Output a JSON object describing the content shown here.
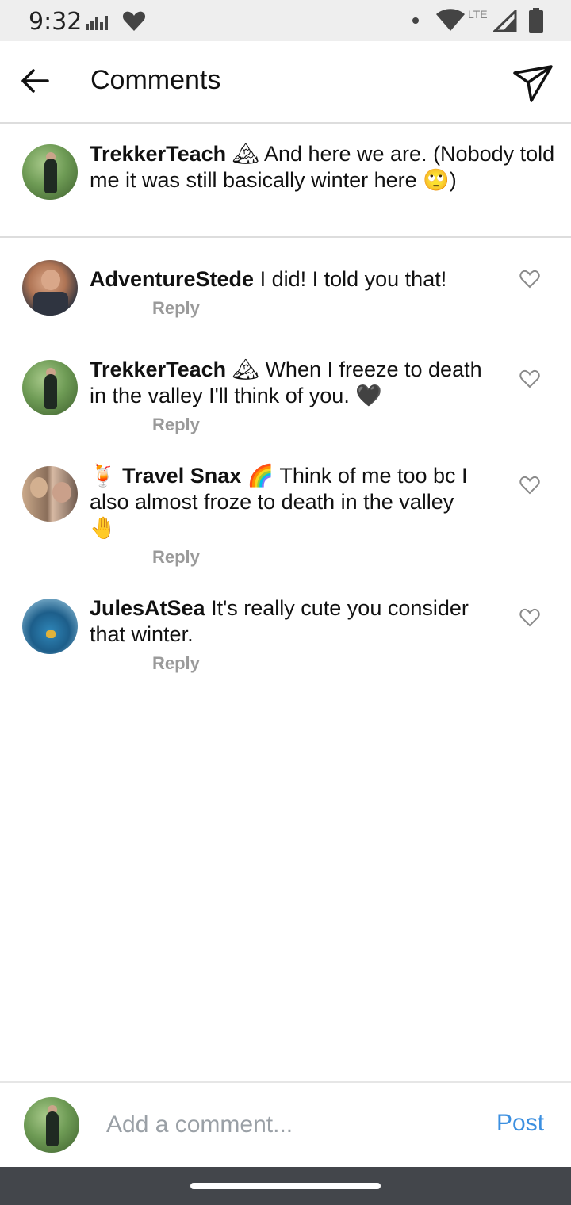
{
  "status_bar": {
    "time": "9:32",
    "network": "LTE"
  },
  "header": {
    "title": "Comments"
  },
  "caption": {
    "username": "TrekkerTeach",
    "username_emoji": "🏔",
    "text": "And here we are. (Nobody told",
    "text_line2": "me it was still basically winter here 🙄)"
  },
  "comments": [
    {
      "username": "AdventureStede",
      "text": "I did! I told you that!",
      "text_line2": "",
      "text_line3": "",
      "reply": "Reply"
    },
    {
      "username": "TrekkerTeach",
      "username_emoji": "🏔",
      "text": "When I freeze to death",
      "text_line2": "in the valley I'll think of you. 🖤",
      "reply": "Reply"
    },
    {
      "username_prefix_emoji": "🍹",
      "username": "Travel Snax",
      "username_emoji": "🌈",
      "text": "Think of me too bc I",
      "text_line2": "also almost froze to death in the valley",
      "text_line3": "🤚",
      "reply": "Reply"
    },
    {
      "username": "JulesAtSea",
      "text": "It's really cute you consider",
      "text_line2": "that winter.",
      "reply": "Reply"
    }
  ],
  "composer": {
    "placeholder": "Add a comment...",
    "post_label": "Post"
  }
}
